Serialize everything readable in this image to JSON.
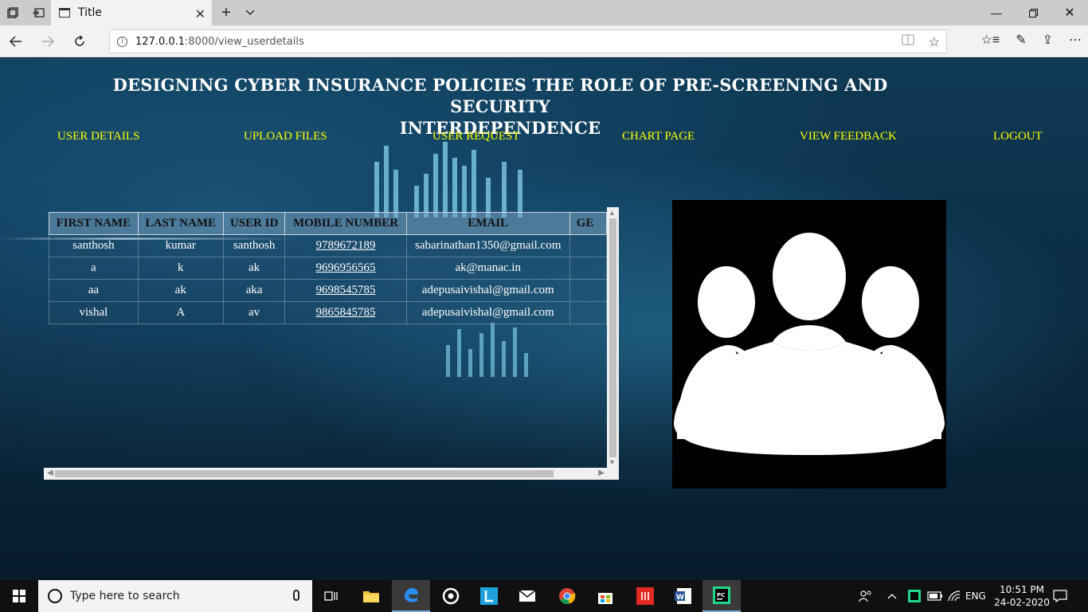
{
  "browser": {
    "tab_title": "Title",
    "url_host": "127.0.0.1",
    "url_rest": ":8000/view_userdetails"
  },
  "page": {
    "title_line1": "DESIGNING CYBER INSURANCE POLICIES THE ROLE OF PRE-SCREENING AND SECURITY",
    "title_line2": "INTERDEPENDENCE",
    "nav": [
      "USER DETAILS",
      "UPLOAD FILES",
      "USER REQUEST",
      "CHART PAGE",
      "VIEW FEEDBACK",
      "LOGOUT"
    ]
  },
  "table": {
    "headers": [
      "FIRST NAME",
      "LAST NAME",
      "USER ID",
      "MOBILE NUMBER",
      "EMAIL",
      "GE"
    ],
    "rows": [
      [
        "santhosh",
        "kumar",
        "santhosh",
        "9789672189",
        "sabarinathan1350@gmail.com",
        ""
      ],
      [
        "a",
        "k",
        "ak",
        "9696956565",
        "ak@manac.in",
        ""
      ],
      [
        "aa",
        "ak",
        "aka",
        "9698545785",
        "adepusaivishal@gmail.com",
        ""
      ],
      [
        "vishal",
        "A",
        "av",
        "9865845785",
        "adepusaivishal@gmail.com",
        ""
      ]
    ]
  },
  "taskbar": {
    "search_placeholder": "Type here to search",
    "lang": "ENG",
    "time": "10:51 PM",
    "date": "24-02-2020"
  }
}
